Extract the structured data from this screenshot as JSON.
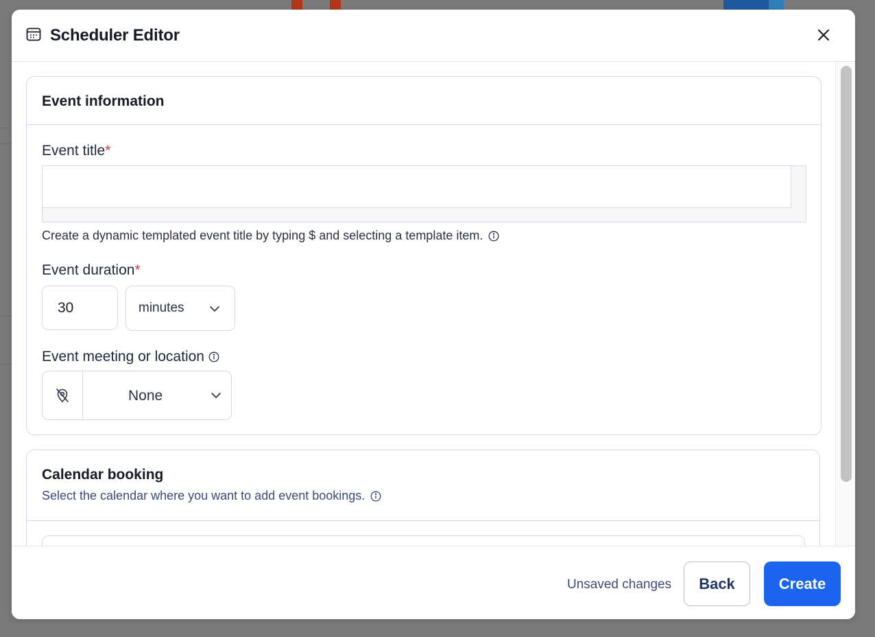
{
  "modal": {
    "title": "Scheduler Editor",
    "header_icon": "calendar-icon",
    "close_icon": "close-icon"
  },
  "event_information": {
    "title": "Event information",
    "event_title": {
      "label": "Event title",
      "required_mark": "*",
      "value": "",
      "help": "Create a dynamic templated event title by typing $ and selecting a template item."
    },
    "event_duration": {
      "label": "Event duration",
      "required_mark": "*",
      "value": "30",
      "unit": "minutes"
    },
    "event_location": {
      "label": "Event meeting or location",
      "value": "None",
      "icon": "location-off-icon"
    }
  },
  "calendar_booking": {
    "title": "Calendar booking",
    "subtitle": "Select the calendar where you want to add event bookings."
  },
  "footer": {
    "status": "Unsaved changes",
    "back_label": "Back",
    "create_label": "Create"
  },
  "colors": {
    "primary": "#1a64f0",
    "required": "#d13b3b",
    "border": "#d4d8ea"
  }
}
